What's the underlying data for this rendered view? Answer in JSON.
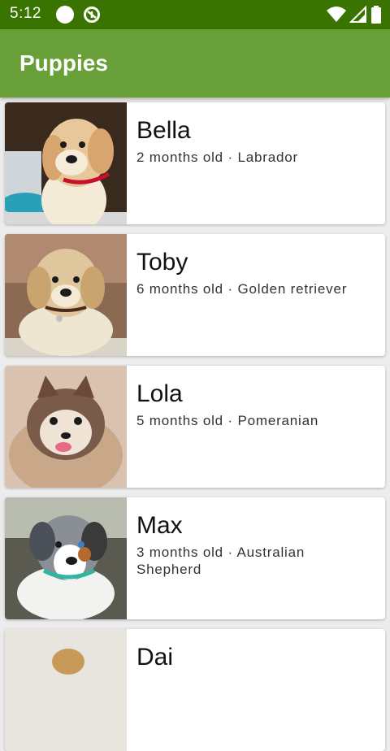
{
  "status_bar": {
    "time": "5:12"
  },
  "app_bar": {
    "title": "Puppies"
  },
  "colors": {
    "status_bar": "#3a7400",
    "app_bar": "#689f38"
  },
  "puppies": [
    {
      "name": "Bella",
      "age": "2 months old",
      "separator": "·",
      "breed": "Labrador"
    },
    {
      "name": "Toby",
      "age": "6 months old",
      "separator": "·",
      "breed": "Golden retriever"
    },
    {
      "name": "Lola",
      "age": "5 months old",
      "separator": "·",
      "breed": "Pomeranian"
    },
    {
      "name": "Max",
      "age": "3 months old",
      "separator": "·",
      "breed": "Australian Shepherd"
    },
    {
      "name": "Dai",
      "age": "",
      "separator": "",
      "breed": ""
    }
  ]
}
